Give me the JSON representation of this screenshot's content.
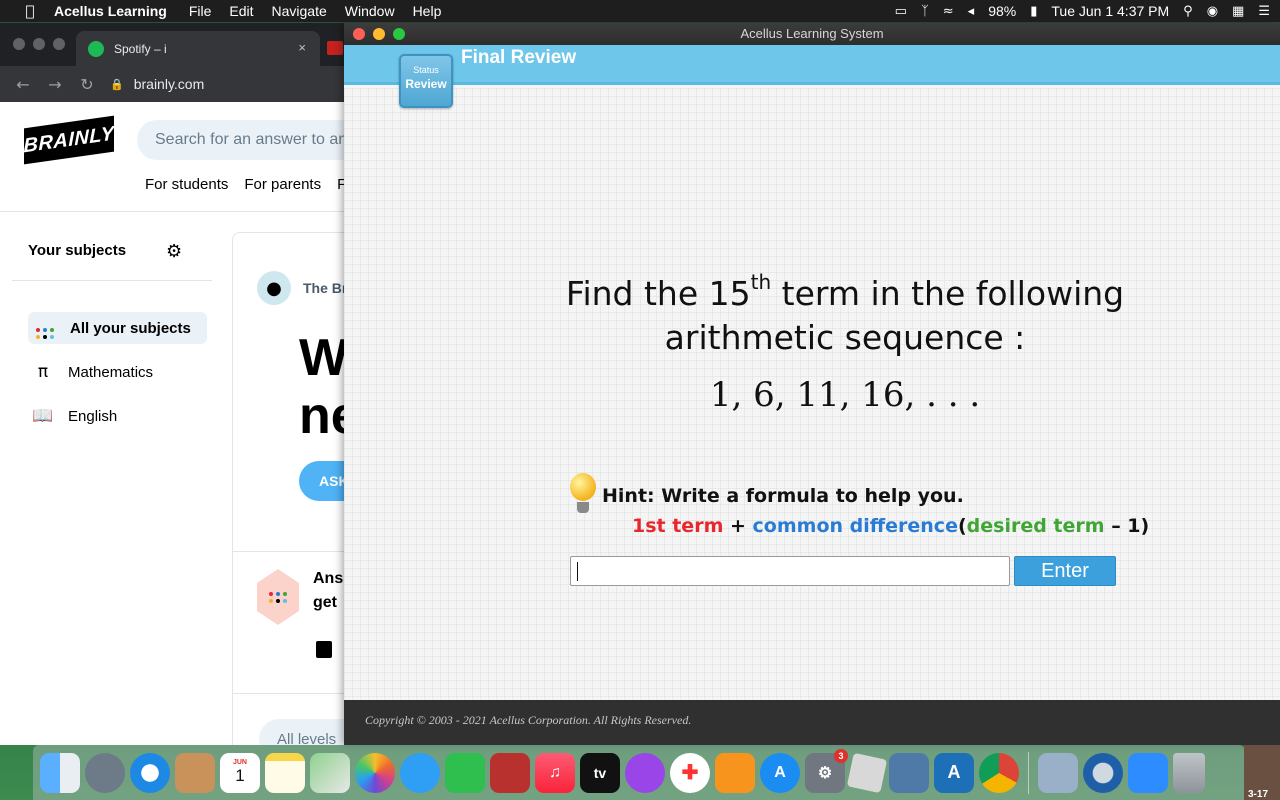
{
  "menubar": {
    "apple": "",
    "app_name": "Acellus Learning",
    "menus": [
      "File",
      "Edit",
      "Navigate",
      "Window",
      "Help"
    ],
    "battery": "98%",
    "datetime": "Tue Jun 1  4:37 PM"
  },
  "chrome": {
    "tab_title": "Spotify – i",
    "tab_close": "×",
    "url": "brainly.com",
    "brainly": {
      "logo": "BRAINLY",
      "search_placeholder": "Search for an answer to any question...",
      "nav": [
        "For students",
        "For parents",
        "Fo"
      ],
      "sidebar_heading": "Your subjects",
      "subjects": [
        "All your subjects",
        "Mathematics",
        "English"
      ],
      "feed_brand": "The Br",
      "feed_big": "W\nne",
      "ask_button": "ASK",
      "answer_promo": "Ans\nget",
      "levels_dropdown": "All levels"
    }
  },
  "acellus": {
    "window_title": "Acellus Learning System",
    "page_title": "Final Review",
    "status_badge": {
      "label_top": "Status",
      "label_bottom": "Review"
    },
    "question_part1": "Find the 15",
    "question_sup": "th",
    "question_part2": " term in the following",
    "question_line2": "arithmetic sequence :",
    "sequence": "1, 6, 11, 16, . . .",
    "hint": "Hint: Write a formula to help you.",
    "formula": {
      "term1": "1st term",
      "plus": " + ",
      "diff": "common difference",
      "open": "(",
      "desired": "desired term",
      "minus": " – 1)",
      "colors": {
        "term1": "#e8262d",
        "diff": "#2a7bd4",
        "desired": "#3fa535"
      }
    },
    "answer_value": "",
    "enter_label": "Enter",
    "footer": "Copyright © 2003 - 2021 Acellus Corporation.  All Rights Reserved."
  },
  "dock": {
    "apps": [
      "finder-icon",
      "launchpad-icon",
      "safari-icon",
      "contacts-icon",
      "calendar-icon",
      "notes-icon",
      "maps-icon",
      "photos-icon",
      "messages-icon",
      "facetime-icon",
      "photobooth-icon",
      "music-icon",
      "tv-icon",
      "podcasts-icon",
      "news-icon",
      "books-icon",
      "appstore-icon",
      "system-preferences-icon",
      "roblox-icon",
      "xcode-icon",
      "acellus-icon",
      "chrome-icon",
      "preview-icon",
      "quicktime-icon",
      "zoom-icon",
      "trash-icon"
    ],
    "calendar_month": "JUN",
    "calendar_day": "1",
    "tv_label": "tv",
    "system_prefs_badge": "3",
    "acellus_label": "A",
    "corner_label": "3-17"
  }
}
